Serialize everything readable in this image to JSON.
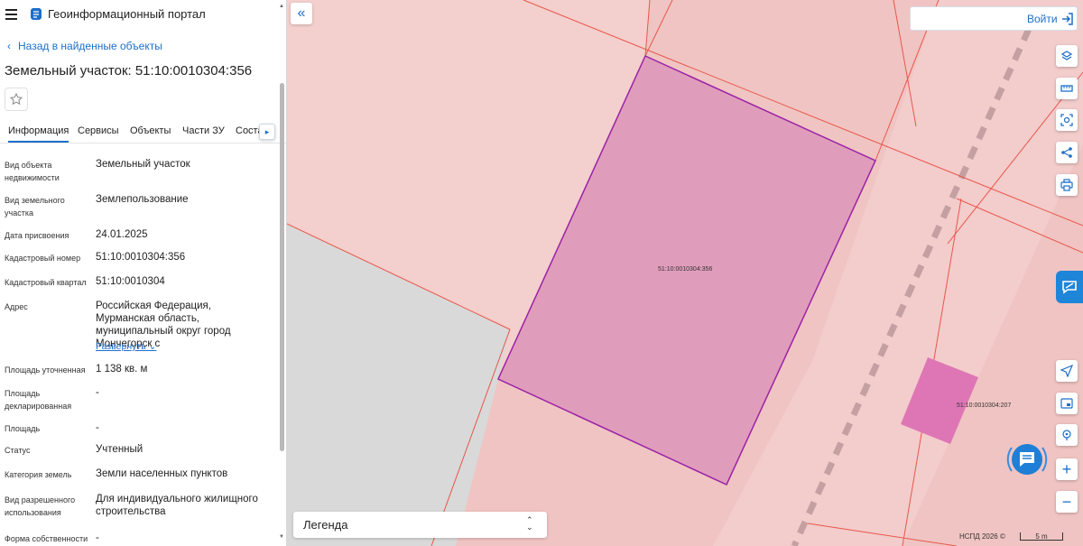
{
  "header": {
    "portal_title": "Геоинформационный портал"
  },
  "nav": {
    "back_label": "Назад в найденные объекты"
  },
  "object": {
    "title": "Земельный участок: 51:10:0010304:356"
  },
  "tabs": [
    {
      "label": "Информация",
      "active": true
    },
    {
      "label": "Сервисы"
    },
    {
      "label": "Объекты"
    },
    {
      "label": "Части ЗУ"
    },
    {
      "label": "Соста"
    }
  ],
  "rows": [
    {
      "label": "Вид объекта недвижимости",
      "value": "Земельный участок"
    },
    {
      "label": "Вид земельного участка",
      "value": "Землепользование"
    },
    {
      "label": "Дата присвоения",
      "value": "24.01.2025"
    },
    {
      "label": "Кадастровый номер",
      "value": "51:10:0010304:356"
    },
    {
      "label": "Кадастровый квартал",
      "value": "51:10:0010304"
    },
    {
      "label": "Адрес",
      "value": "Российская Федерация, Мурманская область, муниципальный округ город Мончегорск с"
    },
    {
      "label": "Площадь уточненная",
      "value": "1 138 кв. м"
    },
    {
      "label": "Площадь декларированная",
      "value": "-"
    },
    {
      "label": "Площадь",
      "value": "-"
    },
    {
      "label": "Статус",
      "value": "Учтенный"
    },
    {
      "label": "Категория земель",
      "value": "Земли населенных пунктов"
    },
    {
      "label": "Вид разрешенного использования",
      "value": "Для индивидуального жилищного строительства"
    },
    {
      "label": "Форма собственности",
      "value": "-"
    }
  ],
  "expand_label": "Развернуть",
  "map": {
    "login_label": "Войти",
    "legend_label": "Легенда",
    "parcel_main_label": "51:10:0010304:356",
    "parcel_small_label": "51:10:0010304:207",
    "attribution": "НСПД 2026 ©",
    "scale_label": "5 m",
    "colors": {
      "background": "#f0c4c2",
      "parcel_selected": "#e09dbb",
      "parcel_small": "#de76b6",
      "boundary": "#e8574a",
      "selection_outline": "#9b22a8",
      "accent": "#1d6fc9"
    }
  },
  "tools": [
    {
      "name": "layers-icon"
    },
    {
      "name": "ruler-icon"
    },
    {
      "name": "select-area-icon"
    },
    {
      "name": "share-icon"
    },
    {
      "name": "print-icon"
    },
    {
      "name": "locate-icon"
    },
    {
      "name": "minimap-icon"
    },
    {
      "name": "geo-search-icon"
    },
    {
      "name": "zoom-in-icon"
    },
    {
      "name": "zoom-out-icon"
    }
  ]
}
